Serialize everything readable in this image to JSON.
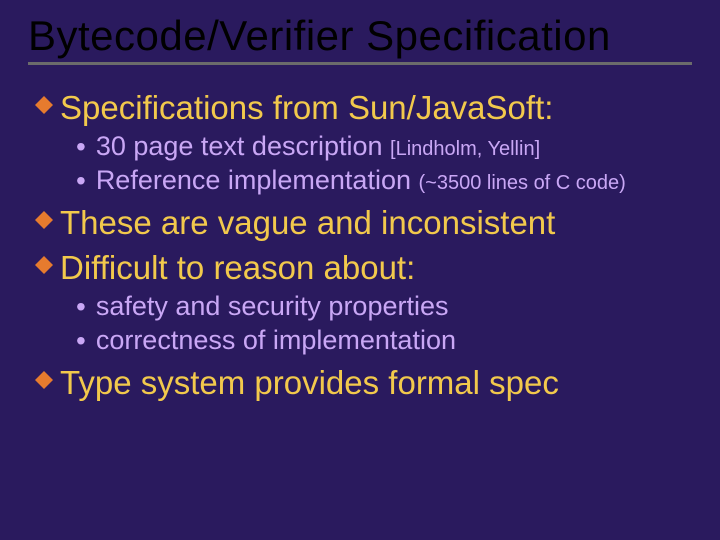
{
  "title": "Bytecode/Verifier Specification",
  "bullets": {
    "b1": {
      "text": "Specifications from Sun/JavaSoft:"
    },
    "b1_1": {
      "main": "30 page text description ",
      "aside": "[Lindholm, Yellin]"
    },
    "b1_2": {
      "main": "Reference implementation ",
      "aside": "(~3500 lines of C code)"
    },
    "b2": {
      "text": "These are vague and inconsistent"
    },
    "b3": {
      "text": "Difficult to reason about:"
    },
    "b3_1": {
      "main": "safety and security properties"
    },
    "b3_2": {
      "main": "correctness of implementation"
    },
    "b4": {
      "text": "Type system provides formal spec"
    }
  }
}
